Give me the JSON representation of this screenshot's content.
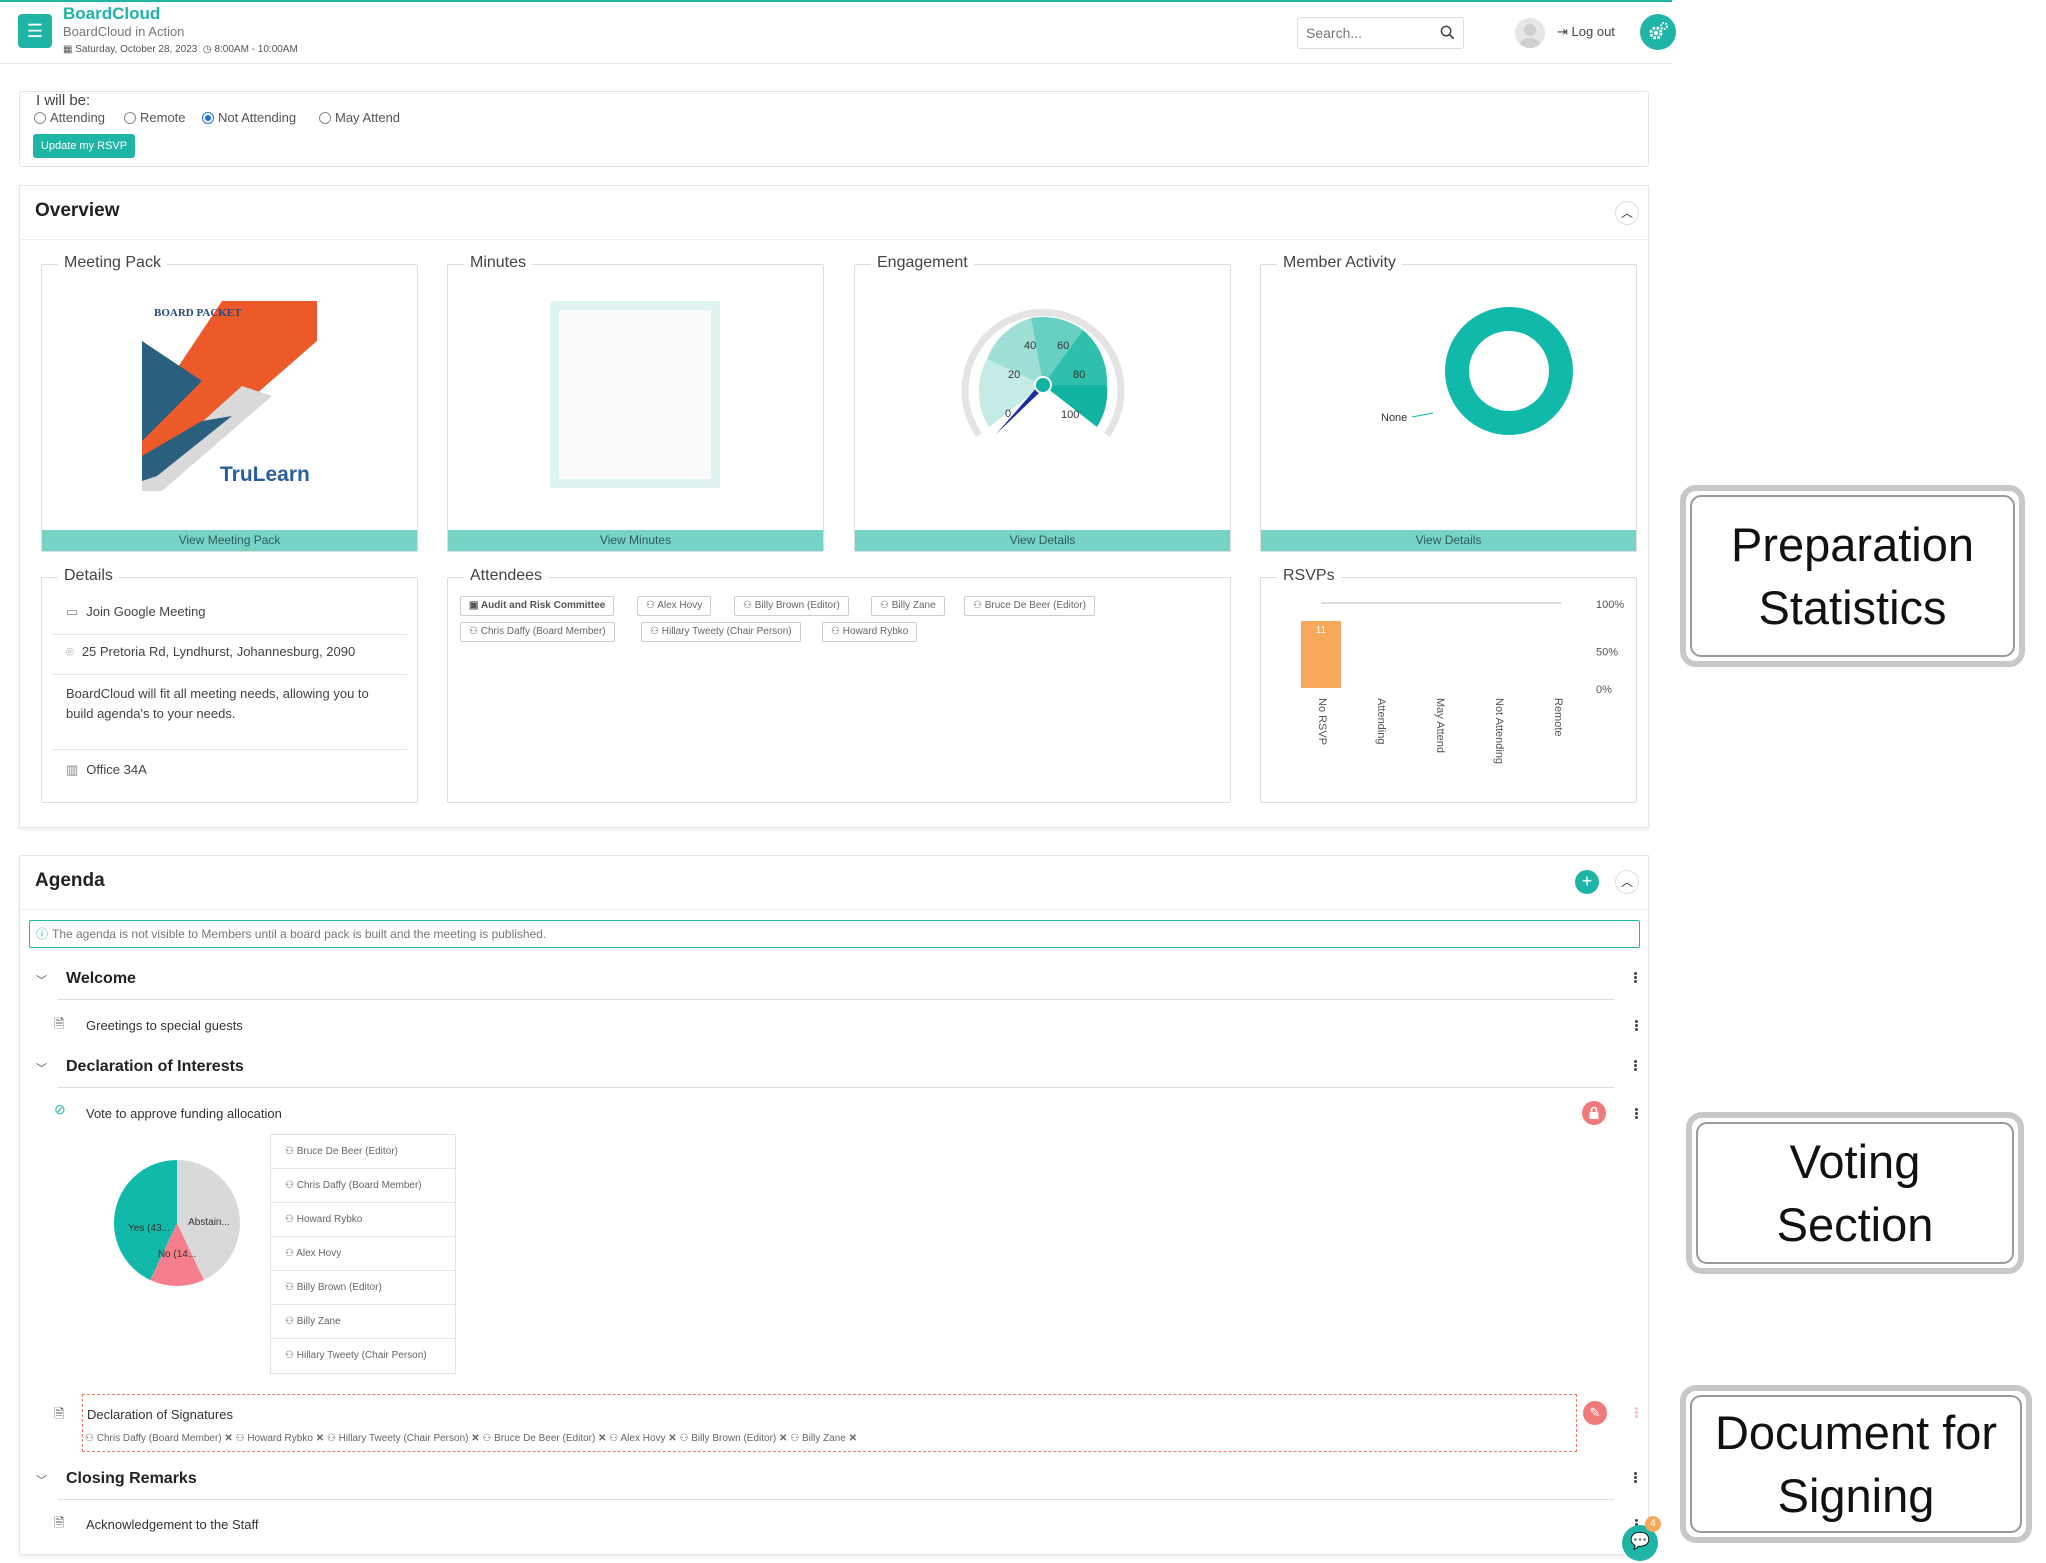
{
  "header": {
    "app_name": "BoardCloud",
    "meeting_name": "BoardCloud in Action",
    "date": "Saturday, October 28, 2023",
    "time": "8:00AM - 10:00AM",
    "search_placeholder": "Search...",
    "logout_label": "Log out"
  },
  "rsvp": {
    "title": "I will be:",
    "options": [
      "Attending",
      "Remote",
      "Not Attending",
      "May Attend"
    ],
    "selected": "Not Attending",
    "button_label": "Update my RSVP"
  },
  "overview": {
    "title": "Overview",
    "meeting_pack": {
      "title": "Meeting Pack",
      "button": "View Meeting Pack",
      "thumb_heading": "BOARD PACKET",
      "thumb_logo": "TruLearn"
    },
    "minutes": {
      "title": "Minutes",
      "button": "View Minutes"
    },
    "engagement": {
      "title": "Engagement",
      "button": "View Details",
      "gauge_ticks": [
        "0",
        "20",
        "40",
        "60",
        "80",
        "100"
      ],
      "gauge_value": 2
    },
    "member_activity": {
      "title": "Member Activity",
      "button": "View Details",
      "slice_label": "None"
    },
    "details": {
      "title": "Details",
      "meeting_link": "Join Google Meeting",
      "address": "25 Pretoria Rd, Lyndhurst, Johannesburg, 2090",
      "description": "BoardCloud will fit all meeting needs, allowing you to build agenda's to your needs.",
      "room": "Office 34A"
    },
    "attendees": {
      "title": "Attendees",
      "committee": "Audit and Risk Committee",
      "people": [
        "Alex Hovy",
        "Billy Brown (Editor)",
        "Billy Zane",
        "Bruce De Beer (Editor)",
        "Chris Daffy (Board Member)",
        "Hillary Tweety (Chair Person)",
        "Howard Rybko"
      ]
    },
    "rsvps": {
      "title": "RSVPs",
      "y_ticks": [
        "100%",
        "50%",
        "0%"
      ]
    }
  },
  "chart_data": [
    {
      "type": "bar",
      "title": "RSVPs",
      "categories": [
        "No RSVP",
        "Attending",
        "May Attend",
        "Not Attending",
        "Remote"
      ],
      "values": [
        11,
        0,
        0,
        0,
        0
      ],
      "data_labels": [
        "11",
        "",
        "",
        "",
        ""
      ],
      "y_tick_labels": [
        "100%",
        "50%",
        "0%"
      ],
      "colors": {
        "bar": "#f7a85b"
      }
    },
    {
      "type": "pie",
      "title": "Member Activity",
      "labels": [
        "None"
      ],
      "values": [
        100
      ],
      "colors": {
        "None": "#10b9a9"
      }
    },
    {
      "type": "pie",
      "title": "",
      "labels": [
        "Yes (43...",
        "Abstain...",
        "No (14..."
      ],
      "values": [
        43,
        43,
        14
      ],
      "colors": {
        "Yes": "#10b9a9",
        "Abstain": "#d9d9d9",
        "No": "#f57f8c"
      }
    }
  ],
  "agenda": {
    "title": "Agenda",
    "notice": "The agenda is not visible to Members until a board pack is built and the meeting is published.",
    "sections": [
      {
        "title": "Welcome",
        "items": [
          "Greetings to special guests"
        ]
      },
      {
        "title": "Declaration of Interests",
        "items": [
          "Vote to approve funding allocation",
          "Declaration of Signatures"
        ]
      },
      {
        "title": "Closing Remarks",
        "items": [
          "Acknowledgement to the Staff"
        ]
      }
    ],
    "voters": [
      "Bruce De Beer (Editor)",
      "Chris Daffy (Board Member)",
      "Howard Rybko",
      "Alex Hovy",
      "Billy Brown (Editor)",
      "Billy Zane",
      "Hillary Tweety (Chair Person)"
    ],
    "signers": [
      "Chris Daffy (Board Member)",
      "Howard Rybko",
      "Hillary Tweety (Chair Person)",
      "Bruce De Beer (Editor)",
      "Alex Hovy",
      "Billy Brown (Editor)",
      "Billy Zane"
    ]
  },
  "chat_badge": "4",
  "annotations": {
    "preparation": [
      "Preparation",
      "Statistics"
    ],
    "voting": [
      "Voting",
      "Section"
    ],
    "signing": [
      "Document for",
      "Signing"
    ]
  },
  "colors": {
    "accent": "#1fb5a6",
    "button_light": "#78d3c7",
    "lock": "#f07a7a",
    "bar": "#f7a85b"
  }
}
